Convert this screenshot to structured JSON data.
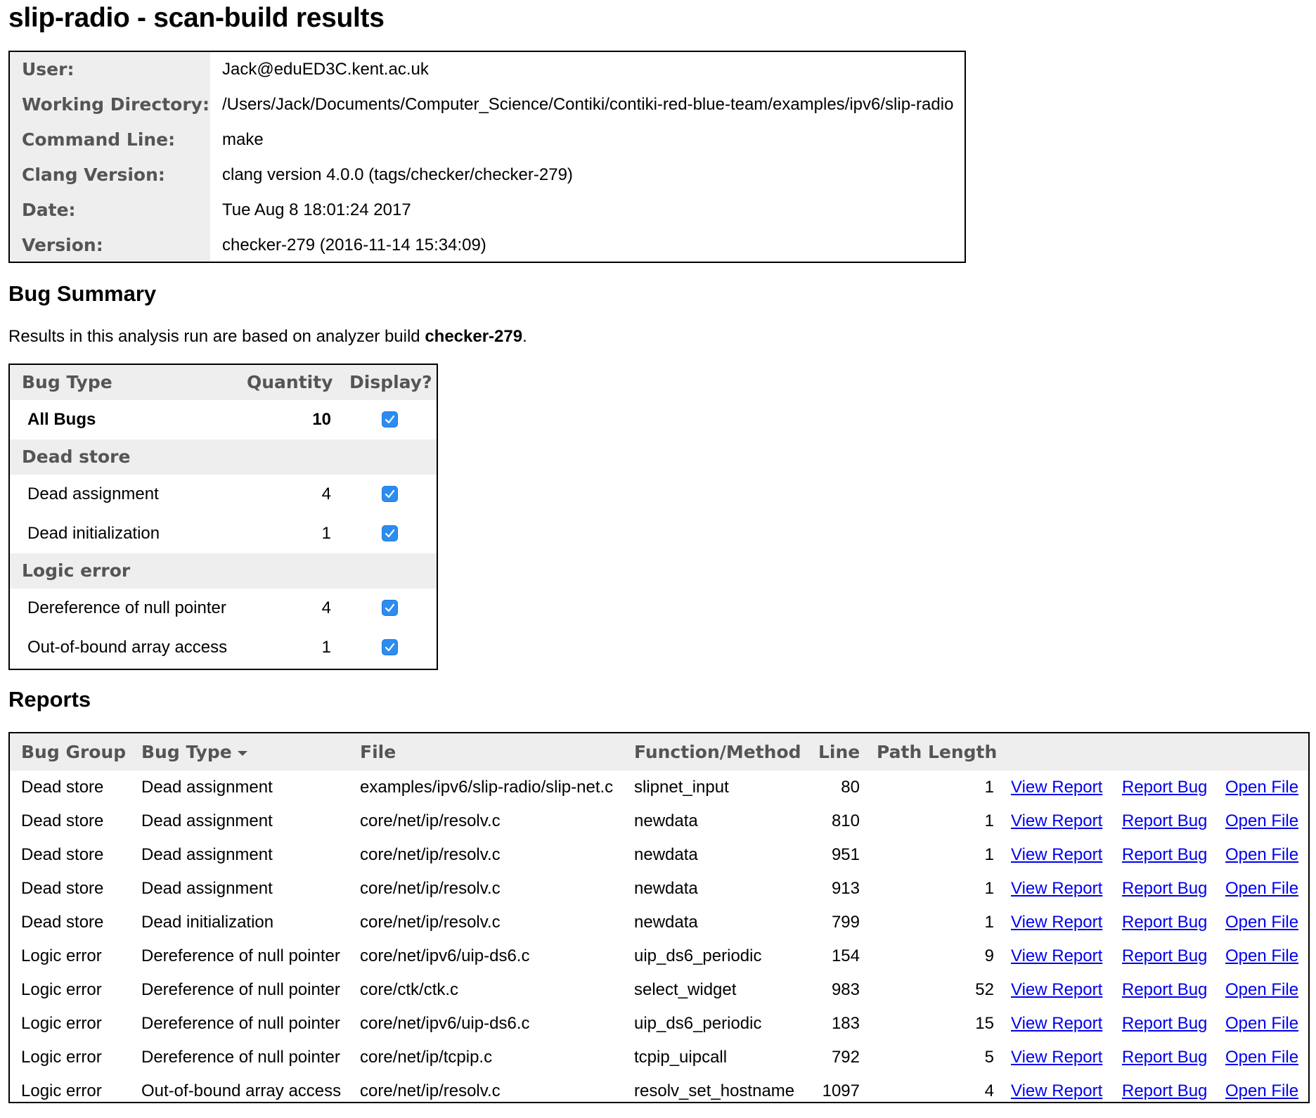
{
  "title": "slip-radio - scan-build results",
  "info": [
    {
      "label": "User:",
      "value": "Jack@eduED3C.kent.ac.uk"
    },
    {
      "label": "Working Directory:",
      "value": "/Users/Jack/Documents/Computer_Science/Contiki/contiki-red-blue-team/examples/ipv6/slip-radio"
    },
    {
      "label": "Command Line:",
      "value": "make"
    },
    {
      "label": "Clang Version:",
      "value": "clang version 4.0.0 (tags/checker/checker-279)"
    },
    {
      "label": "Date:",
      "value": "Tue Aug 8 18:01:24 2017"
    },
    {
      "label": "Version:",
      "value": "checker-279 (2016-11-14 15:34:09)"
    }
  ],
  "bug_summary": {
    "heading": "Bug Summary",
    "text_prefix": "Results in this analysis run are based on analyzer build ",
    "build": "checker-279",
    "text_suffix": ".",
    "headers": {
      "bug_type": "Bug Type",
      "quantity": "Quantity",
      "display": "Display?"
    },
    "all_bugs": {
      "label": "All Bugs",
      "quantity": "10",
      "checked": true
    },
    "categories": [
      {
        "name": "Dead store",
        "items": [
          {
            "label": "Dead assignment",
            "quantity": "4",
            "checked": true
          },
          {
            "label": "Dead initialization",
            "quantity": "1",
            "checked": true
          }
        ]
      },
      {
        "name": "Logic error",
        "items": [
          {
            "label": "Dereference of null pointer",
            "quantity": "4",
            "checked": true
          },
          {
            "label": "Out-of-bound array access",
            "quantity": "1",
            "checked": true
          }
        ]
      }
    ]
  },
  "reports": {
    "heading": "Reports",
    "headers": {
      "bug_group": "Bug Group",
      "bug_type": "Bug Type",
      "file": "File",
      "function": "Function/Method",
      "line": "Line",
      "path_length": "Path Length"
    },
    "link_labels": {
      "view": "View Report",
      "report": "Report Bug",
      "open": "Open File"
    },
    "rows": [
      {
        "group": "Dead store",
        "type": "Dead assignment",
        "file": "examples/ipv6/slip-radio/slip-net.c",
        "function": "slipnet_input",
        "line": "80",
        "path_length": "1"
      },
      {
        "group": "Dead store",
        "type": "Dead assignment",
        "file": "core/net/ip/resolv.c",
        "function": "newdata",
        "line": "810",
        "path_length": "1"
      },
      {
        "group": "Dead store",
        "type": "Dead assignment",
        "file": "core/net/ip/resolv.c",
        "function": "newdata",
        "line": "951",
        "path_length": "1"
      },
      {
        "group": "Dead store",
        "type": "Dead assignment",
        "file": "core/net/ip/resolv.c",
        "function": "newdata",
        "line": "913",
        "path_length": "1"
      },
      {
        "group": "Dead store",
        "type": "Dead initialization",
        "file": "core/net/ip/resolv.c",
        "function": "newdata",
        "line": "799",
        "path_length": "1"
      },
      {
        "group": "Logic error",
        "type": "Dereference of null pointer",
        "file": "core/net/ipv6/uip-ds6.c",
        "function": "uip_ds6_periodic",
        "line": "154",
        "path_length": "9"
      },
      {
        "group": "Logic error",
        "type": "Dereference of null pointer",
        "file": "core/ctk/ctk.c",
        "function": "select_widget",
        "line": "983",
        "path_length": "52"
      },
      {
        "group": "Logic error",
        "type": "Dereference of null pointer",
        "file": "core/net/ipv6/uip-ds6.c",
        "function": "uip_ds6_periodic",
        "line": "183",
        "path_length": "15"
      },
      {
        "group": "Logic error",
        "type": "Dereference of null pointer",
        "file": "core/net/ip/tcpip.c",
        "function": "tcpip_uipcall",
        "line": "792",
        "path_length": "5"
      },
      {
        "group": "Logic error",
        "type": "Out-of-bound array access",
        "file": "core/net/ip/resolv.c",
        "function": "resolv_set_hostname",
        "line": "1097",
        "path_length": "4"
      }
    ]
  },
  "colors": {
    "header_bg": "#eeeeee",
    "header_text": "#555555",
    "link": "#0000ee",
    "checkbox": "#2d8cf0"
  }
}
